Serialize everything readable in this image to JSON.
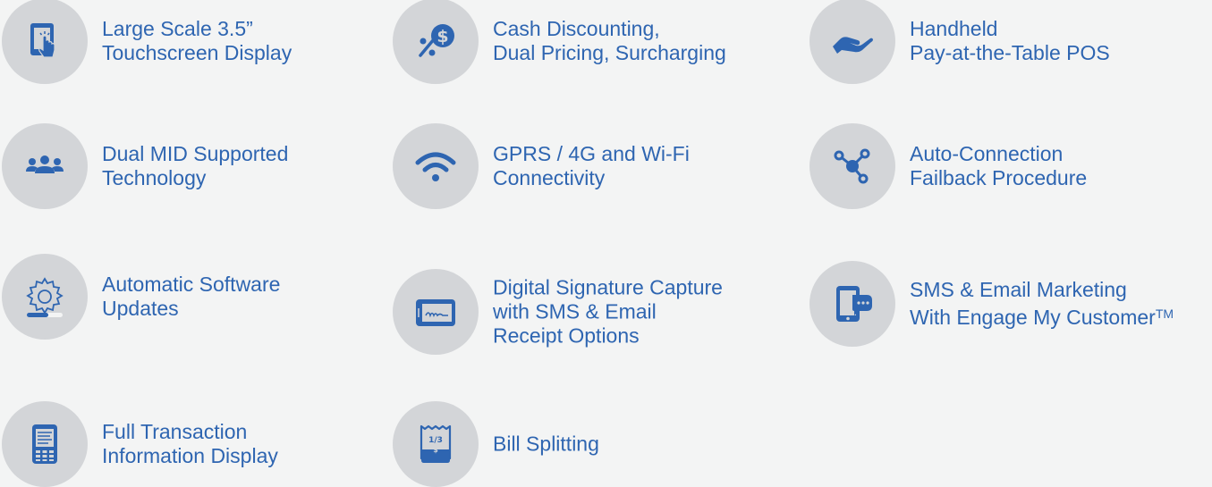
{
  "colors": {
    "accent": "#2e65b1",
    "circle": "#d3d5d8",
    "background": "#f3f4f4"
  },
  "features": [
    {
      "icon": "touchscreen-icon",
      "lines": [
        "Large Scale 3.5”",
        "Touchscreen Display"
      ]
    },
    {
      "icon": "percent-dollar-icon",
      "lines": [
        "Cash Discounting,",
        "Dual Pricing, Surcharging"
      ]
    },
    {
      "icon": "hand-icon",
      "lines": [
        "Handheld",
        "Pay-at-the-Table POS"
      ]
    },
    {
      "icon": "users-icon",
      "lines": [
        "Dual MID Supported",
        "Technology"
      ]
    },
    {
      "icon": "wifi-icon",
      "lines": [
        "GPRS / 4G and Wi-Fi",
        "Connectivity"
      ]
    },
    {
      "icon": "network-nodes-icon",
      "lines": [
        "Auto-Connection",
        "Failback Procedure"
      ]
    },
    {
      "icon": "gear-update-icon",
      "lines": [
        "Automatic Software",
        "Updates"
      ]
    },
    {
      "icon": "signature-tablet-icon",
      "lines": [
        "Digital Signature Capture",
        "with SMS & Email",
        "Receipt Options"
      ]
    },
    {
      "icon": "phone-chat-icon",
      "lines": [
        "SMS & Email Marketing",
        "With Engage My Customer"
      ],
      "tm": "TM"
    },
    {
      "icon": "terminal-display-icon",
      "lines": [
        "Full Transaction",
        "Information Display"
      ]
    },
    {
      "icon": "bill-split-icon",
      "lines": [
        "Bill Splitting"
      ],
      "receipt_text": [
        "1/3",
        "$"
      ]
    }
  ]
}
